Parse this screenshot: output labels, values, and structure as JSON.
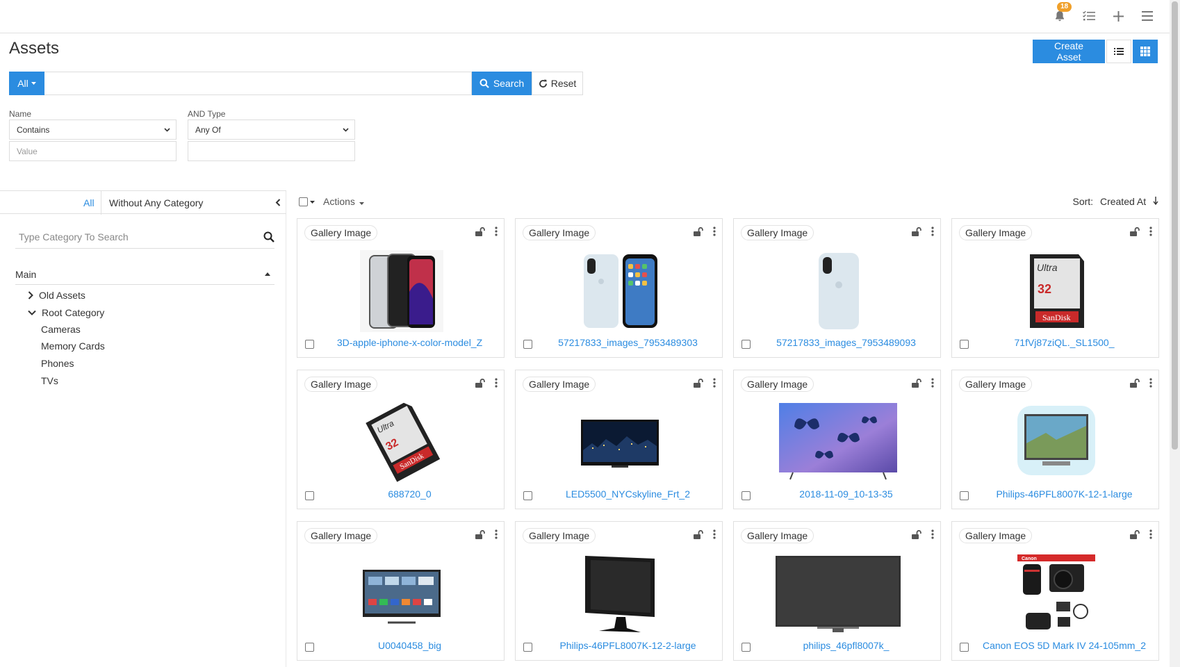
{
  "topbar": {
    "notification_count": "18",
    "icons": [
      "bell-icon",
      "tasks-icon",
      "plus-icon",
      "menu-icon"
    ]
  },
  "page": {
    "title": "Assets",
    "create_label": "Create Asset"
  },
  "search": {
    "scope_label": "All",
    "query": "",
    "search_label": "Search",
    "reset_label": "Reset"
  },
  "filters": {
    "name_label": "Name",
    "name_operator": "Contains",
    "name_value_placeholder": "Value",
    "type_label": "AND Type",
    "type_operator": "Any Of",
    "type_value": ""
  },
  "sidebar": {
    "tab_all": "All",
    "tab_without": "Without Any Category",
    "category_search_placeholder": "Type Category To Search",
    "tree": {
      "root": "Main",
      "old_assets": "Old Assets",
      "root_category": "Root Category",
      "children": [
        "Cameras",
        "Memory Cards",
        "Phones",
        "TVs"
      ]
    }
  },
  "toolbar": {
    "actions_label": "Actions",
    "sort_prefix": "Sort:",
    "sort_field": "Created At"
  },
  "assets": [
    {
      "type": "Gallery Image",
      "name": "3D-apple-iphone-x-color-model_Z",
      "thumb": "phones"
    },
    {
      "type": "Gallery Image",
      "name": "57217833_images_7953489303",
      "thumb": "phone-case-pair"
    },
    {
      "type": "Gallery Image",
      "name": "57217833_images_7953489093",
      "thumb": "phone-case"
    },
    {
      "type": "Gallery Image",
      "name": "71fVj87ziQL._SL1500_",
      "thumb": "sd-card"
    },
    {
      "type": "Gallery Image",
      "name": "688720_0",
      "thumb": "sd-card-tilted"
    },
    {
      "type": "Gallery Image",
      "name": "LED5500_NYCskyline_Frt_2",
      "thumb": "tv-skyline"
    },
    {
      "type": "Gallery Image",
      "name": "2018-11-09_10-13-35",
      "thumb": "tv-butterflies"
    },
    {
      "type": "Gallery Image",
      "name": "Philips-46PFL8007K-12-1-large",
      "thumb": "tv-ambilight"
    },
    {
      "type": "Gallery Image",
      "name": "U0040458_big",
      "thumb": "tv-smart"
    },
    {
      "type": "Gallery Image",
      "name": "Philips-46PFL8007K-12-2-large",
      "thumb": "tv-side"
    },
    {
      "type": "Gallery Image",
      "name": "philips_46pfl8007k_",
      "thumb": "tv-black"
    },
    {
      "type": "Gallery Image",
      "name": "Canon EOS 5D Mark IV 24-105mm_2",
      "thumb": "camera-kit"
    }
  ],
  "colors": {
    "primary": "#2b8ce0",
    "badge": "#f0a02a"
  }
}
